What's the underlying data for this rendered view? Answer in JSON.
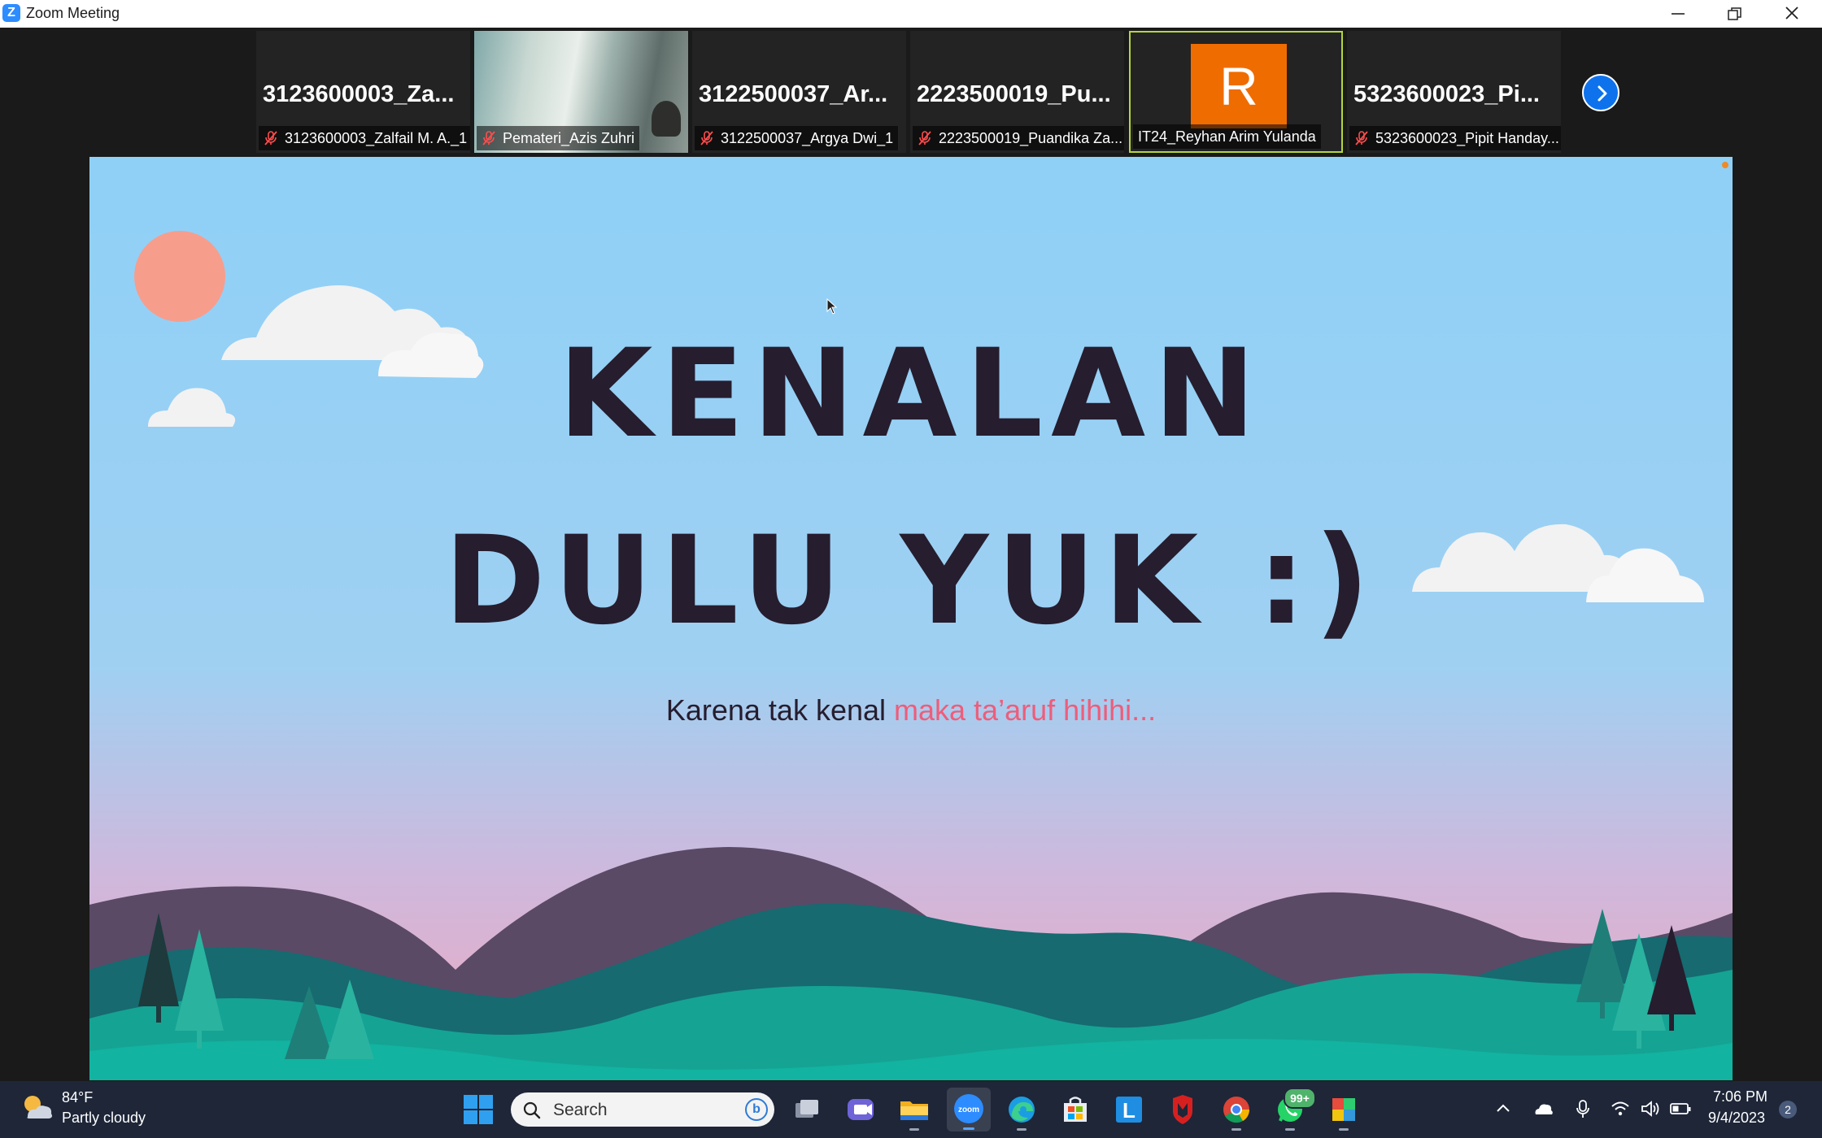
{
  "window": {
    "title": "Zoom Meeting",
    "app_icon": "Z"
  },
  "participants": [
    {
      "display_name": "3123600003_Za...",
      "label": "3123600003_Zalfail M. A._1",
      "muted": true,
      "type": "name"
    },
    {
      "display_name": "",
      "label": "Pemateri_Azis Zuhri",
      "muted": true,
      "type": "video"
    },
    {
      "display_name": "3122500037_Ar...",
      "label": "3122500037_Argya Dwi_1",
      "muted": true,
      "type": "name"
    },
    {
      "display_name": "2223500019_Pu...",
      "label": "2223500019_Puandika Za...",
      "muted": true,
      "type": "name"
    },
    {
      "display_name": "R",
      "label": "IT24_Reyhan Arim Yulanda",
      "muted": false,
      "type": "avatar",
      "active_speaker": true
    },
    {
      "display_name": "5323600023_Pi...",
      "label": "5323600023_Pipit Handay...",
      "muted": true,
      "type": "name"
    }
  ],
  "slide": {
    "title_line1": "KENALAN",
    "title_line2": "DULU YUK :)",
    "subtitle_main": "Karena tak kenal ",
    "subtitle_accent": "maka ta’aruf hihihi...",
    "colors": {
      "sky_top": "#8fd0f7",
      "sky_bottom": "#e6a9c4",
      "title": "#261d2e",
      "accent": "#ee5d7a",
      "sun": "#f79d8c",
      "teal": "#14a89a",
      "mountain": "#5a4a66"
    }
  },
  "taskbar": {
    "weather": {
      "temp": "84°F",
      "desc": "Partly cloudy",
      "icon": "partly-cloudy-icon"
    },
    "search_placeholder": "Search",
    "bing_letter": "b",
    "apps": [
      "task-view-icon",
      "teams-chat-icon",
      "file-explorer-icon",
      "zoom-icon",
      "edge-icon",
      "store-icon",
      "l-app-icon",
      "mcafee-icon",
      "chrome-icon",
      "whatsapp-icon",
      "app-icon"
    ],
    "zoom_icon_text": "zoom",
    "l_app_letter": "L",
    "whatsapp_badge": "99+",
    "clock": {
      "time": "7:06 PM",
      "date": "9/4/2023"
    },
    "notifications": "2"
  }
}
